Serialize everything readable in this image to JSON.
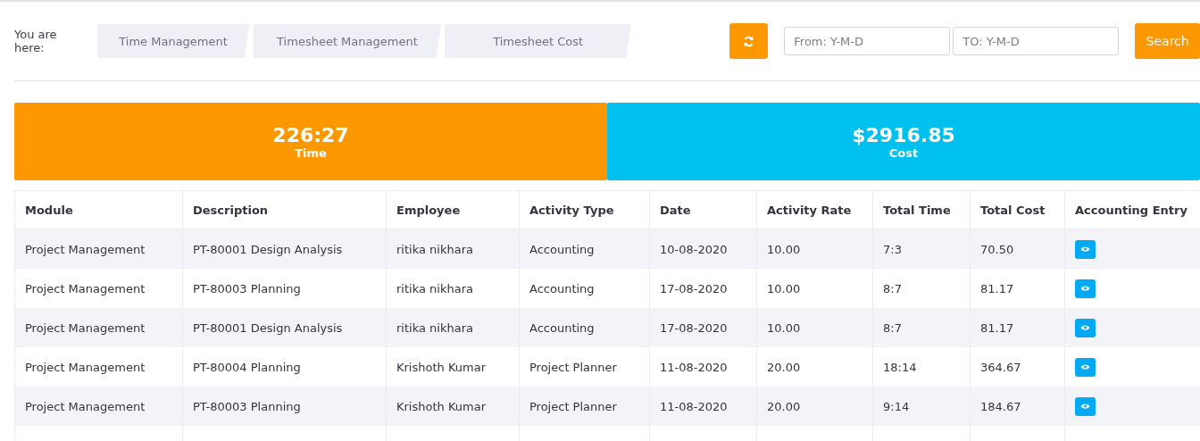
{
  "breadcrumb": {
    "label": "You are here:",
    "items": [
      "Time Management",
      "Timesheet Management",
      "Timesheet Cost"
    ]
  },
  "filters": {
    "from": {
      "placeholder": "From: Y-M-D"
    },
    "to": {
      "placeholder": "TO: Y-M-D"
    },
    "search_button": "Search"
  },
  "stats": [
    {
      "value": "226:27",
      "label": "Time",
      "color": "#fd9800"
    },
    {
      "value": "$2916.85",
      "label": "Cost",
      "color": "#00c0ef"
    }
  ],
  "table": {
    "columns": [
      "Module",
      "Description",
      "Employee",
      "Activity Type",
      "Date",
      "Activity Rate",
      "Total Time",
      "Total Cost",
      "Accounting Entry"
    ],
    "rows": [
      [
        "Project Management",
        "PT-80001 Design Analysis",
        "ritika nikhara",
        "Accounting",
        "10-08-2020",
        "10.00",
        "7:3",
        "70.50"
      ],
      [
        "Project Management",
        "PT-80003 Planning",
        "ritika nikhara",
        "Accounting",
        "17-08-2020",
        "10.00",
        "8:7",
        "81.17"
      ],
      [
        "Project Management",
        "PT-80001 Design Analysis",
        "ritika nikhara",
        "Accounting",
        "17-08-2020",
        "10.00",
        "8:7",
        "81.17"
      ],
      [
        "Project Management",
        "PT-80004 Planning",
        "Krishoth Kumar",
        "Project Planner",
        "11-08-2020",
        "20.00",
        "18:14",
        "364.67"
      ],
      [
        "Project Management",
        "PT-80003 Planning",
        "Krishoth Kumar",
        "Project Planner",
        "11-08-2020",
        "20.00",
        "9:14",
        "184.67"
      ]
    ]
  }
}
